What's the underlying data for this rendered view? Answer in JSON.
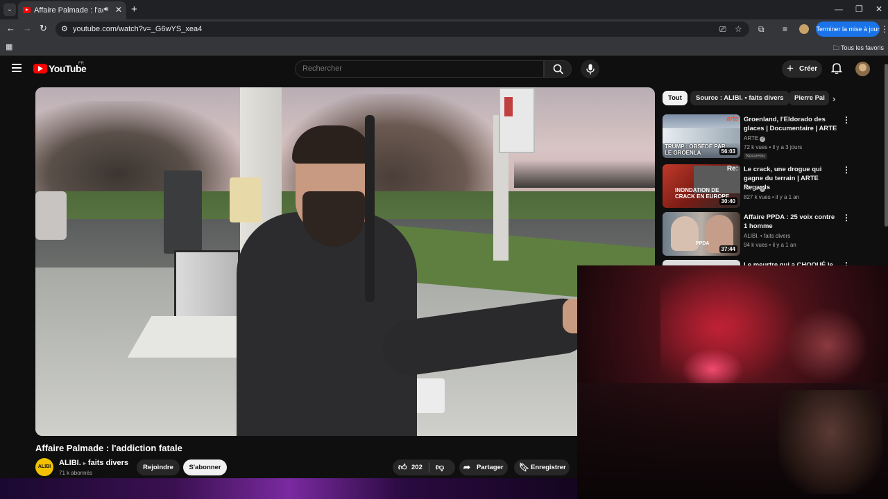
{
  "browser": {
    "tab_title": "Affaire Palmade : l'addictio",
    "url": "youtube.com/watch?v=_G6wYS_xea4",
    "update_button": "Terminer la mise à jour",
    "all_bookmarks": "Tous les favoris"
  },
  "youtube": {
    "logo_text": "YouTube",
    "country_code": "FR",
    "search_placeholder": "Rechercher",
    "create_label": "Créer"
  },
  "video": {
    "title": "Affaire Palmade : l'addiction fatale",
    "channel_avatar_text": "ALIBI",
    "channel_name": "ALIBI.",
    "channel_tag": "faits divers",
    "subscribers": "71 k abonnés",
    "join_label": "Rejoindre",
    "subscribe_label": "S'abonner",
    "likes": "202",
    "share_label": "Partager",
    "save_label": "Enregistrer"
  },
  "sidebar": {
    "chips": [
      "Tout",
      "Source : ALIBI. • faits divers",
      "Pierre Pal"
    ],
    "recommendations": [
      {
        "title": "Groenland, l'Eldorado des glaces | Documentaire | ARTE",
        "channel": "ARTE",
        "meta": "72 k vues • il y a 3 jours",
        "badge": "Nouveau",
        "duration": "56:03",
        "thumb_caption": "TRUMP : OBSÉDÉ PAR LE GROENLA",
        "thumb_logo": "arte"
      },
      {
        "title": "Le crack, une drogue qui gagne du terrain | ARTE Regards",
        "channel": "ARTE",
        "meta": "827 k vues • il y a 1 an",
        "duration": "30:40",
        "thumb_caption": "INONDATION DE CRACK EN EUROPE",
        "thumb_logo": "Re:"
      },
      {
        "title": "Affaire PPDA : 25 voix contre 1 homme",
        "channel": "ALIBI. • faits divers",
        "meta": "94 k vues • il y a 1 an",
        "duration": "37:44",
        "thumb_caption": "PPDA"
      },
      {
        "title": "Le meurtre qui a CHOQUÉ le"
      }
    ]
  },
  "colors": {
    "accent": "#ff0000",
    "update_button": "#1a73e8",
    "background": "#0f0f0f"
  }
}
